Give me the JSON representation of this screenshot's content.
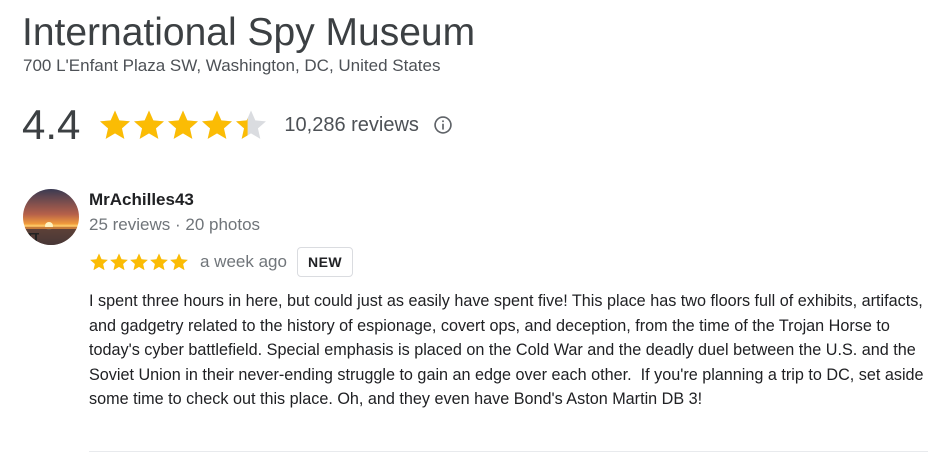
{
  "place": {
    "name": "International Spy Museum",
    "address": "700 L'Enfant Plaza SW, Washington, DC, United States"
  },
  "rating": {
    "value": "4.4",
    "stars_filled": 4.4,
    "stars_max": 5,
    "review_count": "10,286 reviews",
    "info_icon": "info-circle-icon"
  },
  "review": {
    "author": "MrAchilles43",
    "author_meta": "25 reviews · 20 photos",
    "avatar_description": "sunset-over-water-photo",
    "stars": 5,
    "date": "a week ago",
    "badge": "NEW",
    "text": "I spent three hours in here, but could just as easily have spent five! This place has two floors full of exhibits, artifacts, and gadgetry related to the history of espionage, covert ops, and deception, from the time of the Trojan Horse to today's cyber battlefield. Special emphasis is placed on the Cold War and the deadly duel between the U.S. and the Soviet Union in their never-ending struggle to gain an edge over each other.  If you're planning a trip to DC, set aside some time to check out this place. Oh, and they even have Bond's Aston Martin DB 3!"
  },
  "colors": {
    "star_fill": "#fbbc04",
    "star_empty": "#dadce0"
  }
}
